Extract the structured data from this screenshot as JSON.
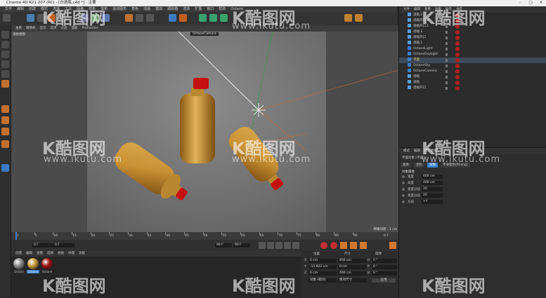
{
  "window": {
    "title": "Cinema 4D R21.207 (RC) - [白酒瓶.c4d *] - 主要"
  },
  "menubar": {
    "items": [
      "文件",
      "编辑",
      "创建",
      "模式",
      "选择",
      "工具",
      "网格",
      "样条",
      "体积",
      "运动图形",
      "角色",
      "动画",
      "模拟",
      "跟踪器",
      "渲染",
      "扩展",
      "窗口",
      "帮助",
      "Octane"
    ]
  },
  "viewport": {
    "menu": [
      "查看",
      "摄像机",
      "显示",
      "选项",
      "过滤",
      "面板",
      "ProRender"
    ],
    "label": "透视视图",
    "camera_label": "OctaneCamera",
    "grid_label": "网格间距 : 1 cm"
  },
  "timeline": {
    "ticks": [
      "0",
      "5",
      "10",
      "15",
      "20",
      "25",
      "30",
      "35",
      "40",
      "45",
      "50",
      "55",
      "60",
      "65",
      "70",
      "75",
      "80",
      "85",
      "90"
    ],
    "end_frame": "0 F"
  },
  "playbar": {
    "start": "0 F",
    "current": "0 F",
    "max1": "90 F",
    "max2": "90 F"
  },
  "materials": {
    "menu": [
      "创建",
      "编辑",
      "查看",
      "选择",
      "材质",
      "纹理",
      "功能"
    ],
    "items": [
      {
        "name": "OctGlo",
        "color": "#8a8a8a"
      },
      {
        "name": "Octane",
        "color": "#c99a3a"
      },
      {
        "name": "Octane",
        "color": "#a01010"
      }
    ]
  },
  "coordinates": {
    "headers": [
      "位置",
      "尺寸",
      "旋转"
    ],
    "rows": [
      {
        "axis": "X",
        "pos": "0 cm",
        "size": "400 cm",
        "rot_axis": "H",
        "rot": "0 °"
      },
      {
        "axis": "Y",
        "pos": "-11.922 cm",
        "size": "0 cm",
        "rot_axis": "P",
        "rot": "0 °"
      },
      {
        "axis": "Z",
        "pos": "0 cm",
        "size": "400 cm",
        "rot_axis": "B",
        "rot": "0 °"
      }
    ],
    "mode1": "对象 (相对)",
    "mode2": "绝对尺寸",
    "apply": "应用"
  },
  "objects": {
    "header": [
      "文件",
      "编辑",
      "查看",
      "对象",
      "标签",
      "书签"
    ],
    "rows": [
      "酒瓶.2",
      "酒瓶开口.2",
      "酒瓶开口.1",
      "酒瓶.1",
      "酒瓶开口",
      "酒瓶.1",
      "OctaneLight",
      "OctaneDaylight",
      "平面",
      "OctaneSky",
      "OctaneCamera",
      "酒瓶",
      "酒瓶",
      "酒瓶开口"
    ]
  },
  "attributes": {
    "header": [
      "模式",
      "编辑",
      "用户数据"
    ],
    "object_title": "平面对象 [平面]",
    "tabs": [
      "基本",
      "坐标",
      "对象",
      "平滑着色(Phong)"
    ],
    "section": "对象属性",
    "fields": [
      {
        "label": "宽度",
        "value": "400 cm"
      },
      {
        "label": "高度",
        "value": "400 cm"
      },
      {
        "label": "宽度分段",
        "value": "20"
      },
      {
        "label": "高度分段",
        "value": "20"
      },
      {
        "label": "方向",
        "value": "+Y"
      }
    ]
  },
  "watermark": {
    "brand": "K酷图网",
    "url": "www.ikutu.com"
  }
}
